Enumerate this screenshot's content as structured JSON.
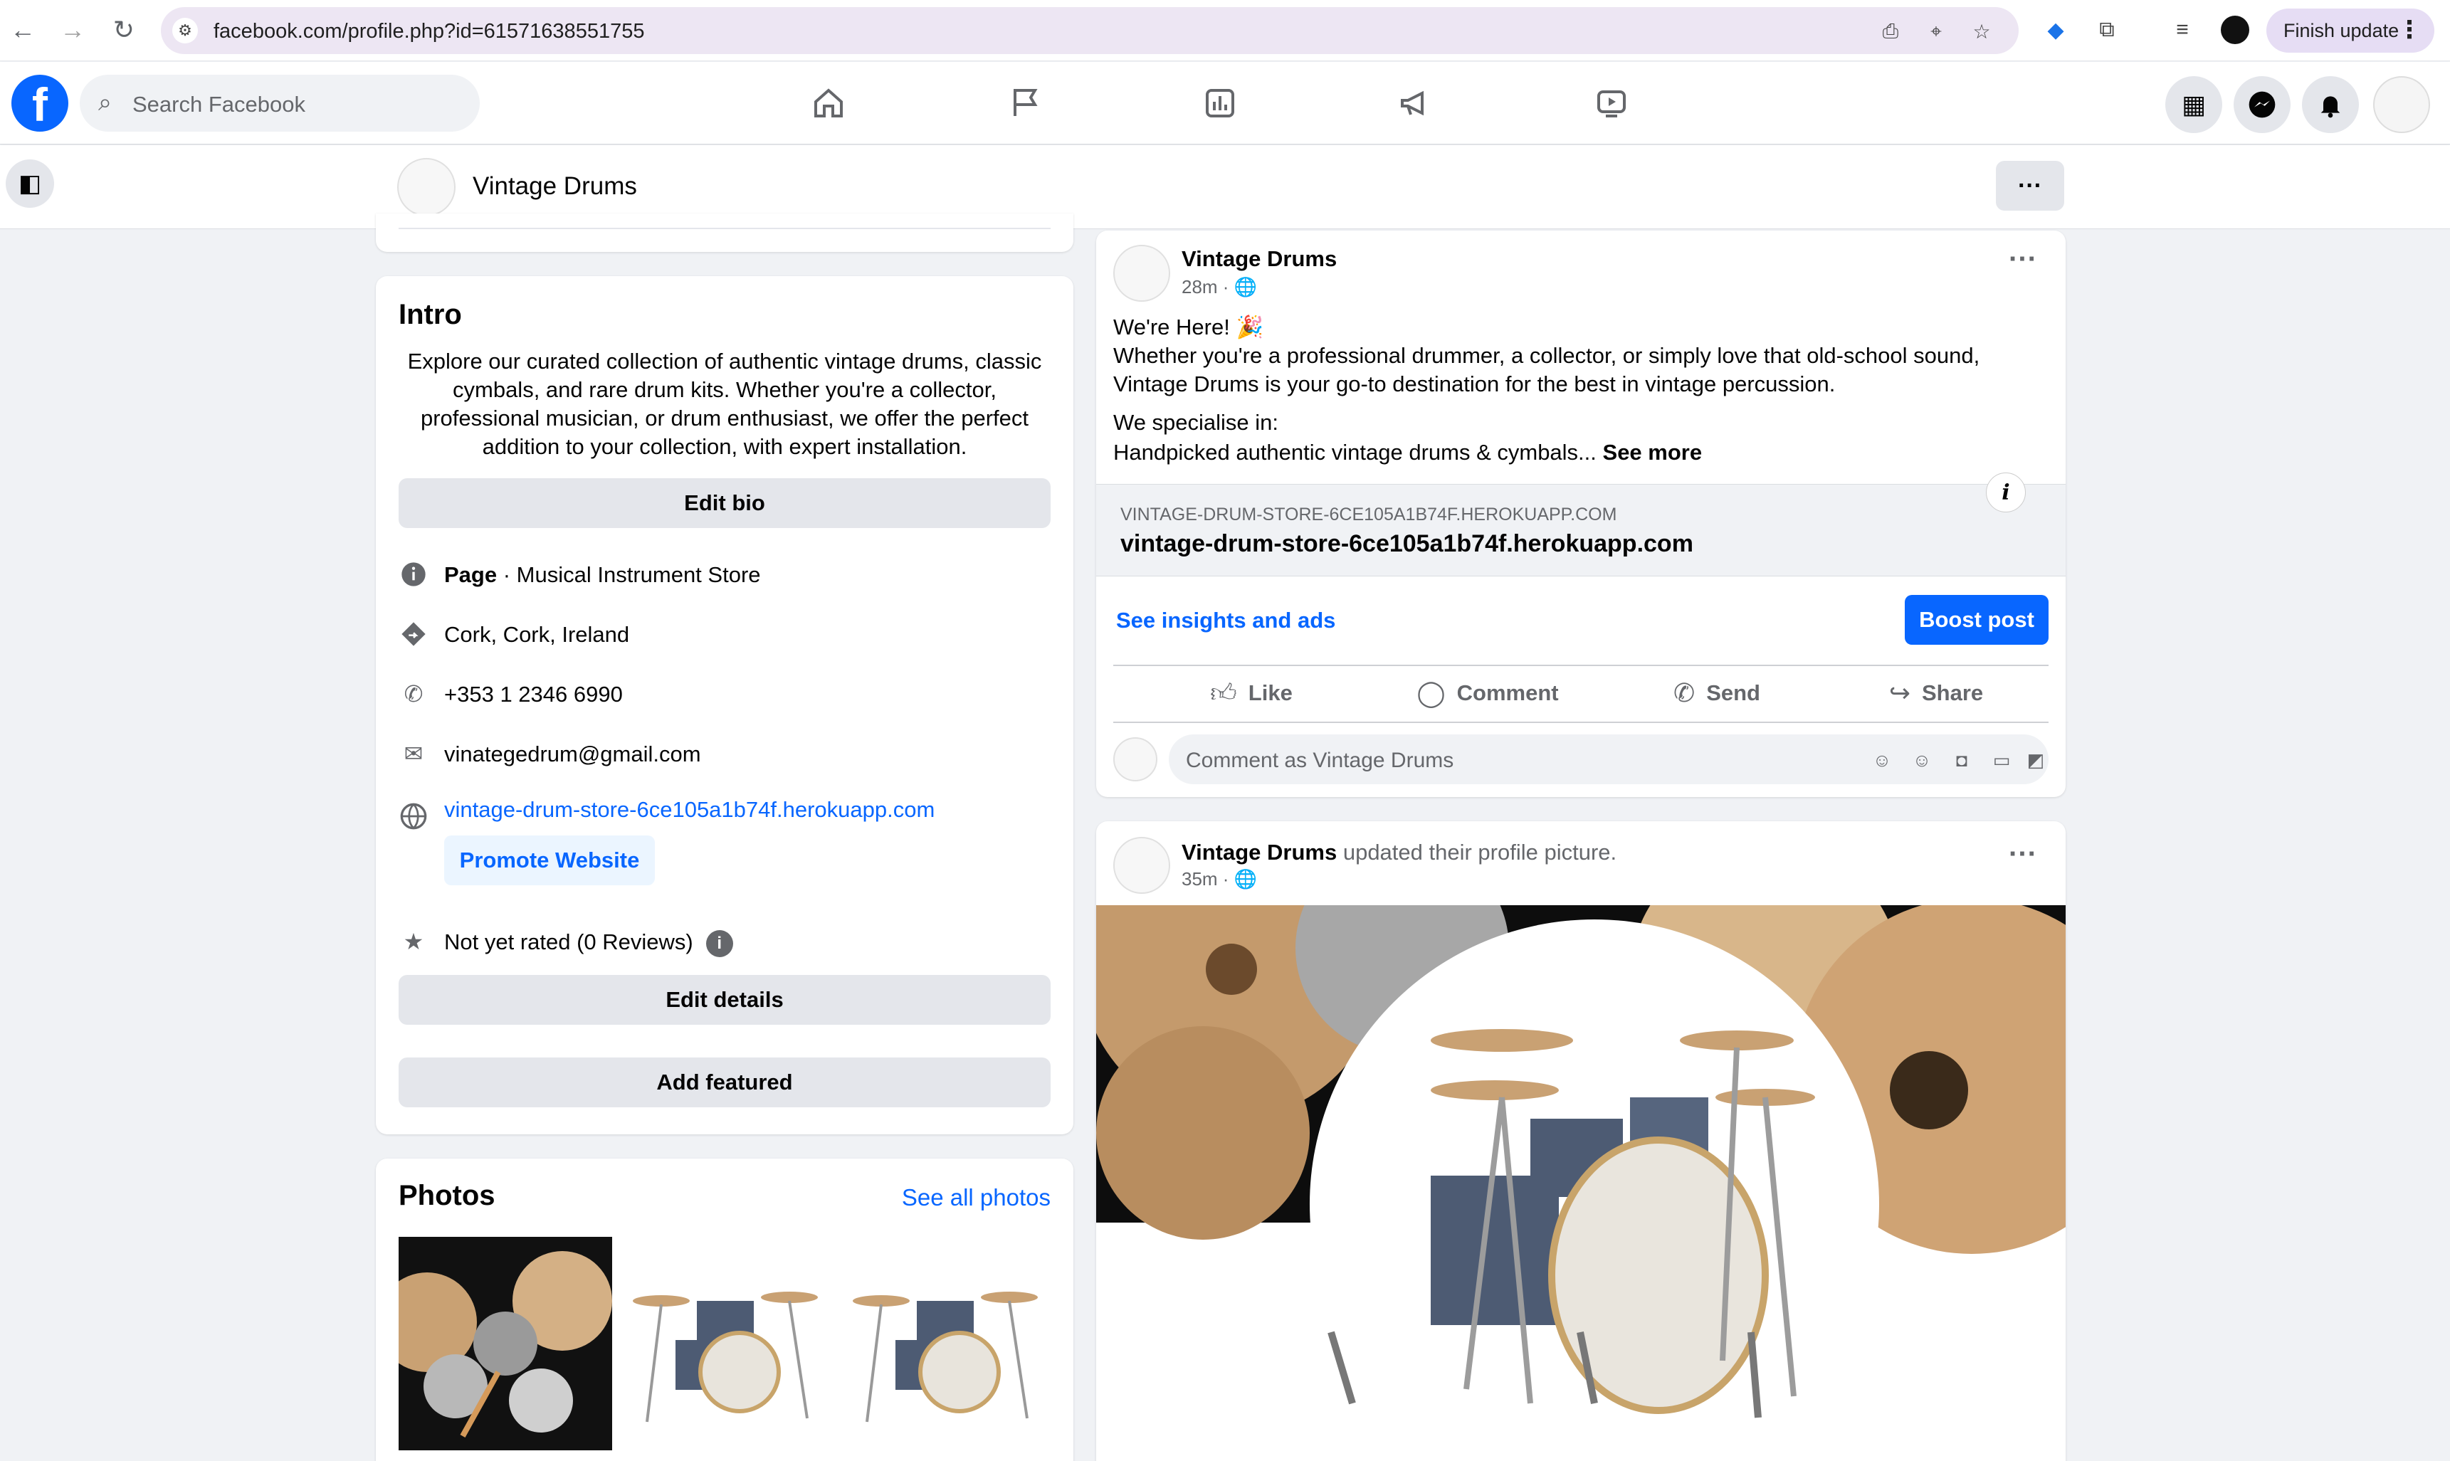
{
  "browser": {
    "url": "facebook.com/profile.php?id=61571638551755",
    "finish_update": "Finish update"
  },
  "nav": {
    "search_placeholder": "Search Facebook"
  },
  "page": {
    "name": "Vintage Drums"
  },
  "intro": {
    "heading": "Intro",
    "bio": "Explore our curated collection of authentic vintage drums, classic cymbals, and rare drum kits. Whether you're a collector, professional musician, or drum enthusiast, we offer the perfect addition to your collection, with expert installation.",
    "edit_bio": "Edit bio",
    "page_label": "Page",
    "category": " · Musical Instrument Store",
    "location": "Cork, Cork, Ireland",
    "phone": "+353 1 2346 6990",
    "email": "vinategedrum@gmail.com",
    "website": "vintage-drum-store-6ce105a1b74f.herokuapp.com",
    "promote_website": "Promote Website",
    "rating": "Not yet rated (0 Reviews)",
    "edit_details": "Edit details",
    "add_featured": "Add featured"
  },
  "photos": {
    "heading": "Photos",
    "see_all": "See all photos"
  },
  "post1": {
    "author": "Vintage Drums",
    "time": "28m · ",
    "line1": "We're Here! 🎉",
    "line2": "Whether you're a professional drummer, a collector, or simply love that old-school sound,",
    "line3": "Vintage Drums is your go-to destination for the best in vintage percussion.",
    "line4": "We specialise in:",
    "line5": "Handpicked authentic vintage drums & cymbals... ",
    "see_more": "See more",
    "link_domain": "VINTAGE-DRUM-STORE-6CE105A1B74F.HEROKUAPP.COM",
    "link_title": "vintage-drum-store-6ce105a1b74f.herokuapp.com",
    "insights": "See insights and ads",
    "boost": "Boost post",
    "like": "Like",
    "comment": "Comment",
    "send": "Send",
    "share": "Share",
    "comment_placeholder": "Comment as Vintage Drums"
  },
  "post2": {
    "author": "Vintage Drums",
    "action": " updated their profile picture.",
    "time": "35m · "
  },
  "colors": {
    "brand_blue": "#0866ff",
    "background": "#f0f2f5"
  }
}
